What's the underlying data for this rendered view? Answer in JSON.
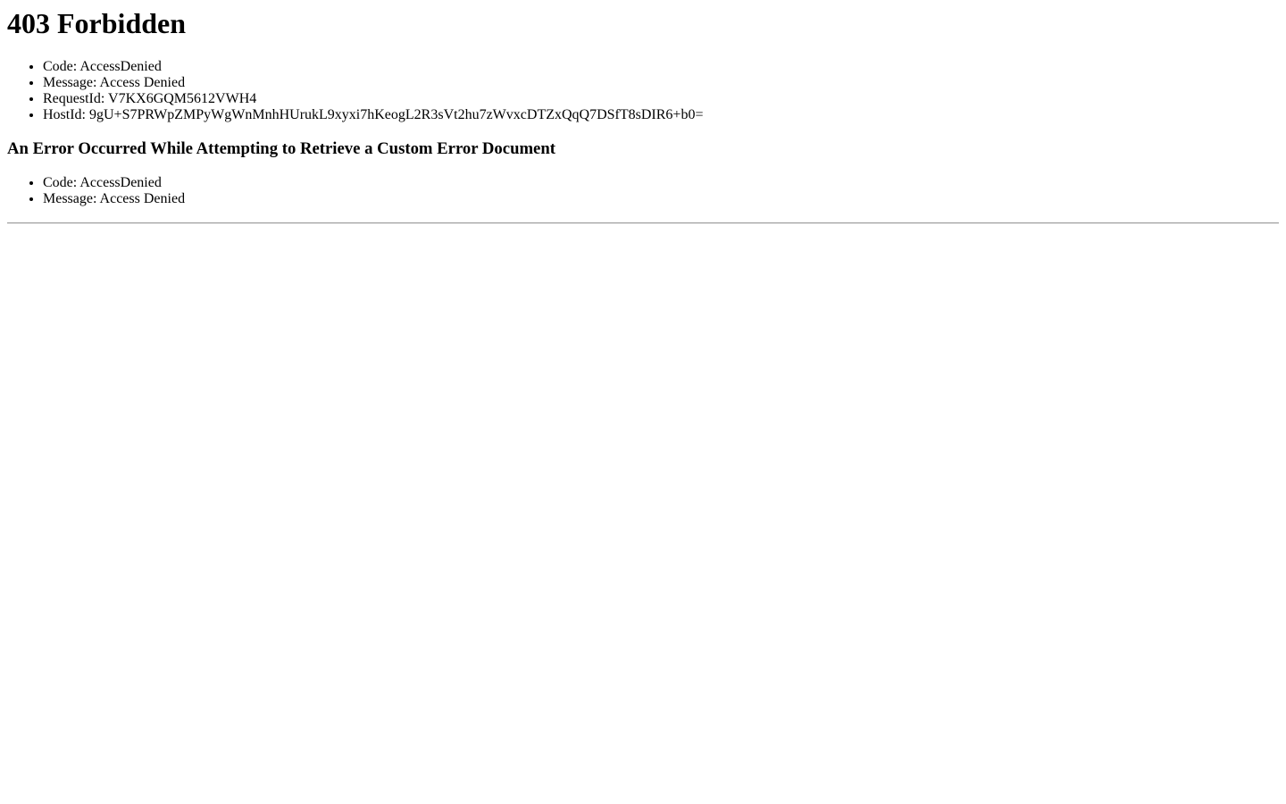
{
  "heading": "403 Forbidden",
  "details": [
    "Code: AccessDenied",
    "Message: Access Denied",
    "RequestId: V7KX6GQM5612VWH4",
    "HostId: 9gU+S7PRWpZMPyWgWnMnhHUrukL9xyxi7hKeogL2R3sVt2hu7zWvxcDTZxQqQ7DSfT8sDIR6+b0="
  ],
  "custom_error": {
    "heading": "An Error Occurred While Attempting to Retrieve a Custom Error Document",
    "details": [
      "Code: AccessDenied",
      "Message: Access Denied"
    ]
  }
}
